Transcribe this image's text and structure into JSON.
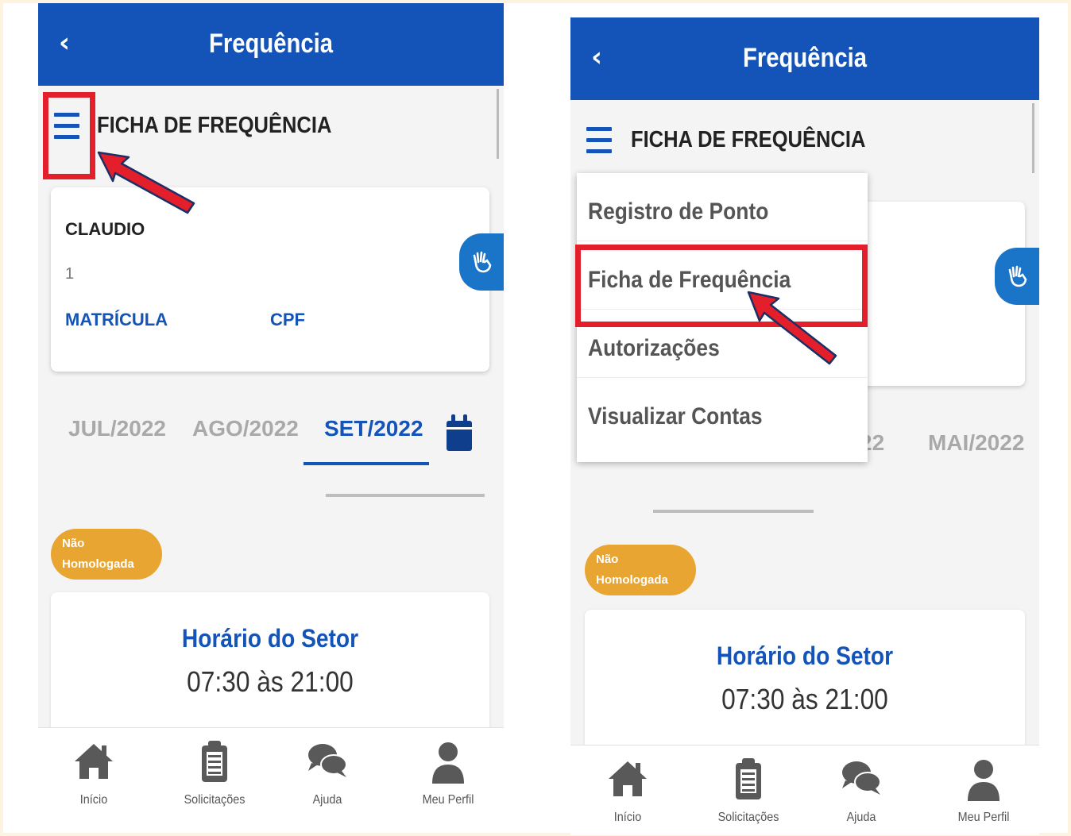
{
  "header": {
    "back_icon": "‹",
    "title": "Frequência"
  },
  "ficha": {
    "title": "FICHA DE FREQUÊNCIA"
  },
  "user": {
    "name": "CLAUDIO",
    "number": "1",
    "matricula_label": "MATRÍCULA",
    "cpf_label": "CPF"
  },
  "months_left": [
    {
      "label": "JUL/2022",
      "active": false
    },
    {
      "label": "AGO/2022",
      "active": false
    },
    {
      "label": "SET/2022",
      "active": true
    }
  ],
  "months_right_visible": {
    "partial": "22",
    "label": "MAI/2022"
  },
  "status_badge": {
    "line1": "Não",
    "line2": "Homologada"
  },
  "schedule": {
    "title": "Horário do Setor",
    "time": "07:30 às 21:00"
  },
  "bottom_nav": [
    {
      "label": "Início",
      "icon": "home-icon"
    },
    {
      "label": "Solicitações",
      "icon": "clipboard-icon"
    },
    {
      "label": "Ajuda",
      "icon": "chat-bubbles-icon"
    },
    {
      "label": "Meu Perfil",
      "icon": "user-icon"
    }
  ],
  "dropdown_menu": [
    {
      "label": "Registro de Ponto"
    },
    {
      "label": "Ficha de Frequência"
    },
    {
      "label": "Autorizações"
    },
    {
      "label": "Visualizar Contas"
    }
  ],
  "colors": {
    "primary": "#1454b8",
    "badge": "#e8a531",
    "highlight": "#e21f2b",
    "libras": "#1a75c8"
  }
}
